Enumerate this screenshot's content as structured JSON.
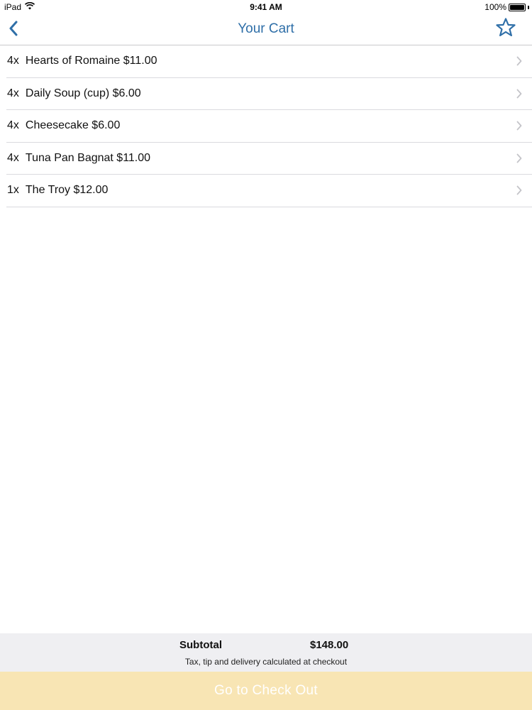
{
  "status_bar": {
    "device": "iPad",
    "time": "9:41 AM",
    "battery": "100%",
    "battery_level": 1.0
  },
  "nav": {
    "title": "Your Cart",
    "back_icon": "chevron-left-icon",
    "favorite_icon": "star-outline-icon"
  },
  "cart": {
    "items": [
      {
        "qty": "4x",
        "label": "Hearts of Romaine $11.00"
      },
      {
        "qty": "4x",
        "label": "Daily Soup (cup) $6.00"
      },
      {
        "qty": "4x",
        "label": "Cheesecake $6.00"
      },
      {
        "qty": "4x",
        "label": "Tuna Pan Bagnat $11.00"
      },
      {
        "qty": "1x",
        "label": "The Troy $12.00"
      }
    ]
  },
  "summary": {
    "subtotal_label": "Subtotal",
    "subtotal_value": "$148.00",
    "note": "Tax, tip and delivery calculated at checkout"
  },
  "checkout": {
    "label": "Go to Check Out"
  },
  "colors": {
    "accent": "#2f6fa8",
    "checkout_bg": "#f8e5b4",
    "summary_bg": "#efeff2"
  }
}
